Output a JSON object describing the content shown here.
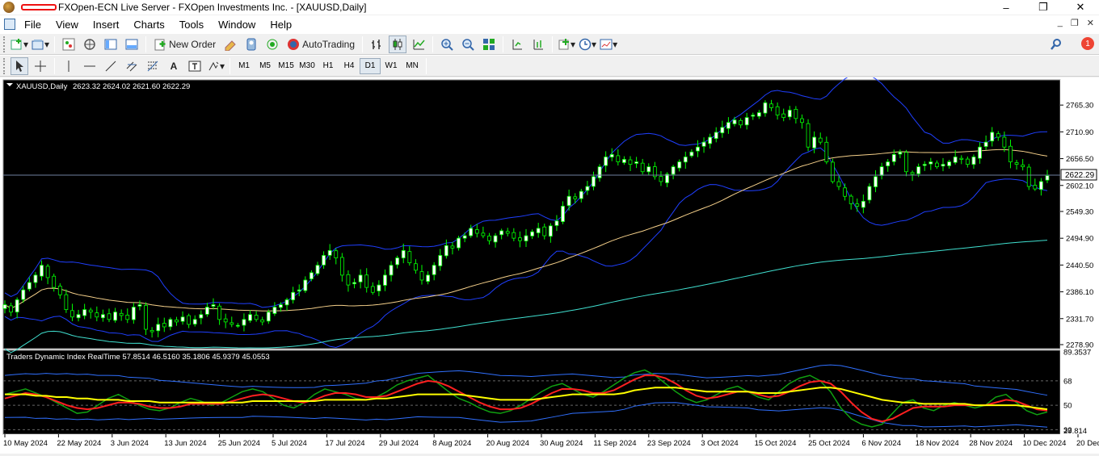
{
  "window": {
    "title": "FXOpen-ECN Live Server - FXOpen Investments Inc. - [XAUUSD,Daily]",
    "controls": [
      "–",
      "❐",
      "✕"
    ]
  },
  "menu": [
    "File",
    "View",
    "Insert",
    "Charts",
    "Tools",
    "Window",
    "Help"
  ],
  "toolbar": {
    "new_order": "New Order",
    "auto_trading": "AutoTrading",
    "notification_count": "1"
  },
  "drawing_tools": {
    "text_tool": "A"
  },
  "timeframes": [
    "M1",
    "M5",
    "M15",
    "M30",
    "H1",
    "H4",
    "D1",
    "W1",
    "MN"
  ],
  "active_timeframe": "D1",
  "colors": {
    "background": "#000000",
    "bull_candle": "#ffffff",
    "bear_candle": "#000000",
    "candle_outline": "#00ff00",
    "bollinger": "#1f3fff",
    "ma_slow": "#f5d08a",
    "ma_200": "#40e0d0",
    "tdi_green": "#10a010",
    "tdi_red": "#ff2020",
    "tdi_yellow": "#ffff00",
    "tdi_band": "#3070ff"
  },
  "chart_data": [
    {
      "type": "candlestick",
      "title": "XAUUSD,Daily",
      "ohlc_label": "2623.32 2624.02 2621.60 2622.29",
      "current_price": "2622.29",
      "ylim": [
        2278.9,
        2800
      ],
      "yticks": [
        "2765.30",
        "2710.90",
        "2656.50",
        "2602.10",
        "2549.30",
        "2494.90",
        "2440.50",
        "2386.10",
        "2331.70",
        "2278.90"
      ],
      "xticks": [
        "10 May 2024",
        "22 May 2024",
        "3 Jun 2024",
        "13 Jun 2024",
        "25 Jun 2024",
        "5 Jul 2024",
        "17 Jul 2024",
        "29 Jul 2024",
        "8 Aug 2024",
        "20 Aug 2024",
        "30 Aug 2024",
        "11 Sep 2024",
        "23 Sep 2024",
        "3 Oct 2024",
        "15 Oct 2024",
        "25 Oct 2024",
        "6 Nov 2024",
        "18 Nov 2024",
        "28 Nov 2024",
        "10 Dec 2024",
        "20 Dec 2024"
      ],
      "close": [
        2360,
        2345,
        2370,
        2390,
        2405,
        2420,
        2440,
        2415,
        2395,
        2380,
        2350,
        2335,
        2340,
        2350,
        2345,
        2335,
        2340,
        2330,
        2345,
        2338,
        2330,
        2355,
        2360,
        2310,
        2305,
        2320,
        2315,
        2330,
        2325,
        2335,
        2320,
        2330,
        2340,
        2355,
        2360,
        2330,
        2325,
        2320,
        2318,
        2330,
        2340,
        2330,
        2325,
        2345,
        2355,
        2360,
        2370,
        2385,
        2390,
        2410,
        2425,
        2440,
        2460,
        2470,
        2455,
        2420,
        2400,
        2405,
        2420,
        2395,
        2385,
        2400,
        2420,
        2440,
        2455,
        2470,
        2445,
        2430,
        2410,
        2420,
        2440,
        2460,
        2480,
        2475,
        2495,
        2500,
        2515,
        2505,
        2500,
        2490,
        2500,
        2510,
        2505,
        2495,
        2490,
        2500,
        2508,
        2515,
        2500,
        2520,
        2530,
        2560,
        2580,
        2575,
        2590,
        2600,
        2620,
        2640,
        2660,
        2665,
        2650,
        2655,
        2645,
        2650,
        2630,
        2640,
        2620,
        2610,
        2625,
        2640,
        2650,
        2660,
        2670,
        2680,
        2690,
        2700,
        2710,
        2720,
        2730,
        2735,
        2725,
        2740,
        2745,
        2750,
        2770,
        2760,
        2745,
        2740,
        2755,
        2738,
        2730,
        2680,
        2700,
        2690,
        2650,
        2610,
        2600,
        2580,
        2565,
        2560,
        2570,
        2600,
        2620,
        2640,
        2650,
        2665,
        2670,
        2630,
        2625,
        2640,
        2645,
        2650,
        2640,
        2645,
        2650,
        2660,
        2655,
        2645,
        2660,
        2680,
        2690,
        2710,
        2700,
        2680,
        2650,
        2645,
        2640,
        2600,
        2595,
        2610,
        2622
      ]
    },
    {
      "type": "line",
      "title": "Traders Dynamic Index RealTime 57.8514 46.5160 35.1806 45.9379 45.0553",
      "yticks": [
        "89.3537",
        "68",
        "50",
        "32",
        "29.814"
      ],
      "ylim": [
        29.814,
        89.3537
      ],
      "levels": [
        68,
        50,
        32
      ],
      "series": [
        {
          "values": [
            58,
            60,
            62,
            59,
            56,
            52,
            48,
            44,
            45,
            50,
            55,
            58,
            54,
            50,
            47,
            46,
            48,
            52,
            55,
            53,
            50,
            52,
            56,
            60,
            62,
            60,
            55,
            50,
            48,
            52,
            58,
            62,
            60,
            58,
            55,
            54,
            56,
            60,
            65,
            68,
            70,
            72,
            66,
            60,
            55,
            52,
            48,
            45,
            44,
            46,
            50,
            55,
            60,
            64,
            66,
            62,
            58,
            56,
            60,
            65,
            70,
            74,
            76,
            72,
            66,
            60,
            55,
            52,
            54,
            58,
            62,
            64,
            60,
            56,
            54,
            60,
            66,
            70,
            72,
            68,
            60,
            48,
            40,
            36,
            34,
            36,
            44,
            52,
            54,
            48,
            46,
            50,
            52,
            50,
            48,
            50,
            56,
            58,
            52,
            46,
            43,
            45
          ]
        },
        {
          "values": [
            55,
            57,
            59,
            58,
            56,
            53,
            50,
            48,
            47,
            48,
            50,
            52,
            52,
            51,
            49,
            48,
            48,
            49,
            51,
            51,
            51,
            51,
            53,
            55,
            57,
            58,
            57,
            55,
            53,
            52,
            54,
            57,
            59,
            59,
            58,
            56,
            56,
            57,
            60,
            63,
            66,
            68,
            67,
            64,
            60,
            56,
            52,
            49,
            47,
            47,
            48,
            51,
            55,
            59,
            62,
            62,
            61,
            59,
            59,
            61,
            65,
            69,
            72,
            72,
            70,
            66,
            61,
            57,
            55,
            56,
            58,
            60,
            60,
            58,
            56,
            57,
            60,
            64,
            67,
            68,
            66,
            60,
            52,
            45,
            40,
            38,
            40,
            44,
            48,
            49,
            49,
            49,
            50,
            50,
            50,
            50,
            52,
            54,
            53,
            50,
            47,
            46
          ]
        },
        {
          "values": [
            58,
            58,
            58,
            57,
            57,
            56,
            56,
            55,
            55,
            54,
            54,
            54,
            53,
            53,
            53,
            52,
            52,
            52,
            52,
            52,
            52,
            52,
            52,
            52,
            53,
            53,
            53,
            53,
            53,
            53,
            53,
            54,
            54,
            54,
            54,
            54,
            55,
            55,
            56,
            57,
            58,
            58,
            58,
            58,
            58,
            57,
            56,
            55,
            54,
            54,
            54,
            54,
            55,
            56,
            57,
            58,
            58,
            58,
            58,
            58,
            59,
            61,
            62,
            63,
            63,
            63,
            62,
            61,
            60,
            60,
            60,
            60,
            60,
            59,
            59,
            59,
            60,
            61,
            62,
            63,
            63,
            62,
            60,
            58,
            56,
            54,
            53,
            52,
            52,
            51,
            51,
            51,
            51,
            51,
            50,
            50,
            50,
            50,
            50,
            49,
            48,
            47
          ]
        }
      ]
    }
  ]
}
